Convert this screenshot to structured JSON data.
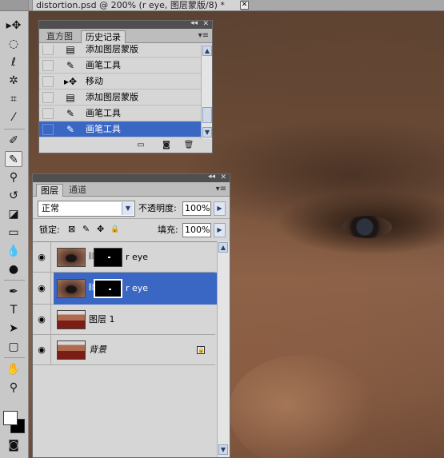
{
  "window": {
    "doc_tab_title": "distortion.psd @ 200% (r eye, 图层蒙版/8) *",
    "close_glyph": "✕"
  },
  "tools": [
    {
      "name": "move-tool-icon",
      "glyph": "▸✥"
    },
    {
      "name": "marquee-tool-icon",
      "glyph": "◌"
    },
    {
      "name": "lasso-tool-icon",
      "glyph": "ℓ"
    },
    {
      "name": "magic-wand-tool-icon",
      "glyph": "✲"
    },
    {
      "name": "crop-tool-icon",
      "glyph": "⌗"
    },
    {
      "name": "eyedropper-tool-icon",
      "glyph": "⁄"
    },
    {
      "name": "healing-brush-tool-icon",
      "glyph": "✐"
    },
    {
      "name": "brush-tool-icon",
      "glyph": "✎"
    },
    {
      "name": "clone-stamp-tool-icon",
      "glyph": "⚲"
    },
    {
      "name": "history-brush-tool-icon",
      "glyph": "↺"
    },
    {
      "name": "eraser-tool-icon",
      "glyph": "◪"
    },
    {
      "name": "gradient-tool-icon",
      "glyph": "▭"
    },
    {
      "name": "blur-tool-icon",
      "glyph": "💧"
    },
    {
      "name": "dodge-tool-icon",
      "glyph": "●"
    },
    {
      "name": "pen-tool-icon",
      "glyph": "✒"
    },
    {
      "name": "type-tool-icon",
      "glyph": "T"
    },
    {
      "name": "path-selection-tool-icon",
      "glyph": "➤"
    },
    {
      "name": "shape-tool-icon",
      "glyph": "▢"
    },
    {
      "name": "hand-tool-icon",
      "glyph": "✋"
    },
    {
      "name": "zoom-tool-icon",
      "glyph": "⚲"
    },
    {
      "name": "quick-mask-icon",
      "glyph": "◙"
    }
  ],
  "history_panel": {
    "tabs": [
      "直方图",
      "历史记录"
    ],
    "rows": [
      {
        "icon": "layer-mask-icon",
        "glyph": "▤",
        "label": "添加图层蒙版",
        "selected": false
      },
      {
        "icon": "brush-icon",
        "glyph": "✎",
        "label": "画笔工具",
        "selected": false
      },
      {
        "icon": "move-icon",
        "glyph": "▸✥",
        "label": "移动",
        "selected": false
      },
      {
        "icon": "layer-mask-icon",
        "glyph": "▤",
        "label": "添加图层蒙版",
        "selected": false
      },
      {
        "icon": "brush-icon",
        "glyph": "✎",
        "label": "画笔工具",
        "selected": false
      },
      {
        "icon": "brush-icon",
        "glyph": "✎",
        "label": "画笔工具",
        "selected": true
      }
    ],
    "panel_glyphs": {
      "collapse": "◂◂",
      "close": "✕",
      "menu": "▾≡",
      "up": "▲",
      "down": "▼"
    },
    "footer_glyphs": [
      "▭",
      "◙",
      "🗑"
    ]
  },
  "layers_panel": {
    "tabs": [
      "图层",
      "通道"
    ],
    "blend_mode": "正常",
    "opacity_label": "不透明度:",
    "opacity_value": "100%",
    "lock_label": "锁定:",
    "lock_glyphs": [
      "⊠",
      "✎",
      "✥",
      "🔒"
    ],
    "fill_label": "填充:",
    "fill_value": "100%",
    "glyphs": {
      "eye": "◉",
      "link": "⛓",
      "arrow": "▶",
      "dropdown": "▼",
      "up": "▲",
      "down": "▼",
      "lock": "🔒"
    },
    "layers": [
      {
        "name": "r eye",
        "has_mask": true,
        "selected": false,
        "locked": false,
        "italic": false,
        "thumb": "eye"
      },
      {
        "name": "r eye",
        "has_mask": true,
        "selected": true,
        "locked": false,
        "italic": false,
        "thumb": "eye"
      },
      {
        "name": "图层 1",
        "has_mask": false,
        "selected": false,
        "locked": false,
        "italic": false,
        "thumb": "person"
      },
      {
        "name": "背景",
        "has_mask": false,
        "selected": false,
        "locked": true,
        "italic": true,
        "thumb": "person"
      }
    ]
  },
  "colors": {
    "selection": "#3a66c4",
    "panel_bg": "#d6d6d6",
    "grip": "#4f4f4f"
  }
}
